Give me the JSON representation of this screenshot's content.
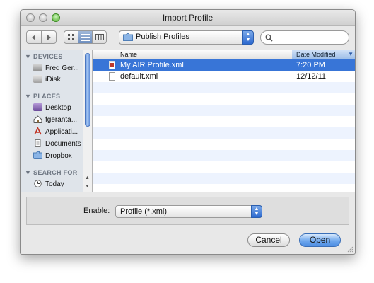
{
  "window": {
    "title": "Import Profile"
  },
  "toolbar": {
    "back_icon": "triangle-left-icon",
    "forward_icon": "triangle-right-icon",
    "location": "Publish Profiles",
    "search_placeholder": ""
  },
  "sidebar": {
    "devices_header": "DEVICES",
    "places_header": "PLACES",
    "search_header": "SEARCH FOR",
    "devices": [
      {
        "label": "Fred Ger..."
      },
      {
        "label": "iDisk"
      }
    ],
    "places": [
      {
        "label": "Desktop"
      },
      {
        "label": "fgeranta..."
      },
      {
        "label": "Applicati..."
      },
      {
        "label": "Documents"
      },
      {
        "label": "Dropbox"
      }
    ],
    "search": [
      {
        "label": "Today"
      }
    ]
  },
  "file_list": {
    "columns": {
      "name": "Name",
      "date": "Date Modified"
    },
    "rows": [
      {
        "name": "My AIR Profile.xml",
        "date": "7:20 PM",
        "selected": true
      },
      {
        "name": "default.xml",
        "date": "12/12/11",
        "selected": false
      }
    ]
  },
  "bottom": {
    "enable_label": "Enable:",
    "enable_value": "Profile (*.xml)"
  },
  "buttons": {
    "cancel": "Cancel",
    "open": "Open"
  },
  "colors": {
    "selection": "#3875d7",
    "stripe": "#edf3fe",
    "sidebar": "#dfe4ea",
    "default_button": "#6fa8ee"
  }
}
